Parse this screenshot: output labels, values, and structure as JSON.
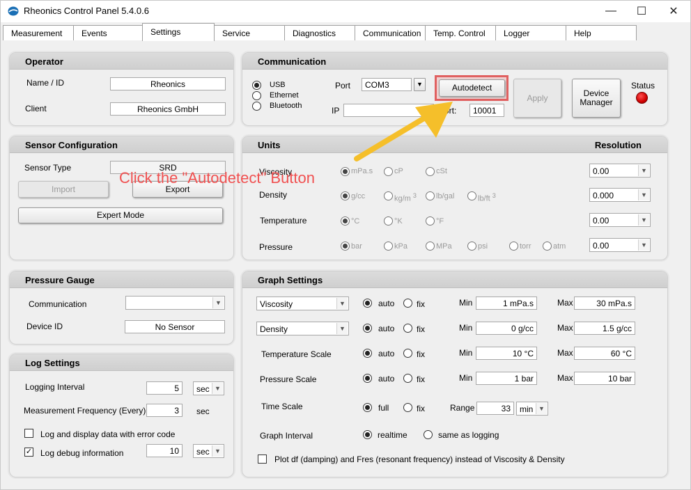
{
  "window": {
    "title": "Rheonics Control Panel 5.4.0.6",
    "minimize": "—",
    "maximize": "☐",
    "close": "✕"
  },
  "tabs": [
    "Measurement",
    "Events",
    "Settings",
    "Service",
    "Diagnostics",
    "Communication",
    "Temp. Control",
    "Logger",
    "Help"
  ],
  "operator": {
    "title": "Operator",
    "name_label": "Name / ID",
    "name_value": "Rheonics",
    "client_label": "Client",
    "client_value": "Rheonics GmbH"
  },
  "communication": {
    "title": "Communication",
    "usb": "USB",
    "ethernet": "Ethernet",
    "bluetooth": "Bluetooth",
    "port_label": "Port",
    "port_value": "COM3",
    "ip_label": "IP",
    "ip_value": "",
    "port2_label": "Port:",
    "port2_value": "10001",
    "autodetect": "Autodetect",
    "apply": "Apply",
    "device_manager": "Device Manager",
    "status_label": "Status",
    "status_color": "#e00000"
  },
  "sensor": {
    "title": "Sensor Configuration",
    "type_label": "Sensor Type",
    "type_value": "SRD",
    "import": "Import",
    "export": "Export",
    "expert": "Expert Mode"
  },
  "annotation": "Click the \"Autodetect\" Button",
  "units": {
    "title": "Units",
    "resolution_label": "Resolution",
    "viscosity": {
      "label": "Viscosity",
      "opts": [
        "mPa.s",
        "cP",
        "cSt"
      ],
      "res": "0.00"
    },
    "density": {
      "label": "Density",
      "opts": [
        "g/cc",
        "kg/m",
        "lb/gal",
        "lb/ft"
      ],
      "sup": "3",
      "res": "0.000"
    },
    "temperature": {
      "label": "Temperature",
      "opts": [
        "°C",
        "°K",
        "°F"
      ],
      "res": "0.00"
    },
    "pressure": {
      "label": "Pressure",
      "opts": [
        "bar",
        "kPa",
        "MPa",
        "psi",
        "torr",
        "atm"
      ],
      "res": "0.00"
    }
  },
  "gauge": {
    "title": "Pressure Gauge",
    "comm_label": "Communication",
    "comm_value": "",
    "device_label": "Device ID",
    "device_value": "No Sensor"
  },
  "graph": {
    "title": "Graph Settings",
    "auto": "auto",
    "fix": "fix",
    "min": "Min",
    "max": "Max",
    "row1": {
      "select": "Viscosity",
      "min": "1 mPa.s",
      "max": "30 mPa.s"
    },
    "row2": {
      "select": "Density",
      "min": "0 g/cc",
      "max": "1.5 g/cc"
    },
    "row3": {
      "label": "Temperature Scale",
      "min": "10 °C",
      "max": "60 °C"
    },
    "row4": {
      "label": "Pressure Scale",
      "min": "1 bar",
      "max": "10 bar"
    },
    "time": {
      "label": "Time Scale",
      "full": "full",
      "fix": "fix",
      "range_label": "Range",
      "range_value": "33",
      "unit": "min"
    },
    "interval": {
      "label": "Graph Interval",
      "realtime": "realtime",
      "same": "same as logging"
    },
    "plot_df": "Plot df (damping) and Fres (resonant frequency) instead of Viscosity & Density"
  },
  "log": {
    "title": "Log Settings",
    "interval_label": "Logging Interval",
    "interval_value": "5",
    "interval_unit": "sec",
    "freq_label": "Measurement Frequency (Every)",
    "freq_value": "3",
    "freq_unit": "sec",
    "error_label": "Log and display data with error code",
    "debug_label": "Log debug information",
    "debug_value": "10",
    "debug_unit": "sec"
  }
}
